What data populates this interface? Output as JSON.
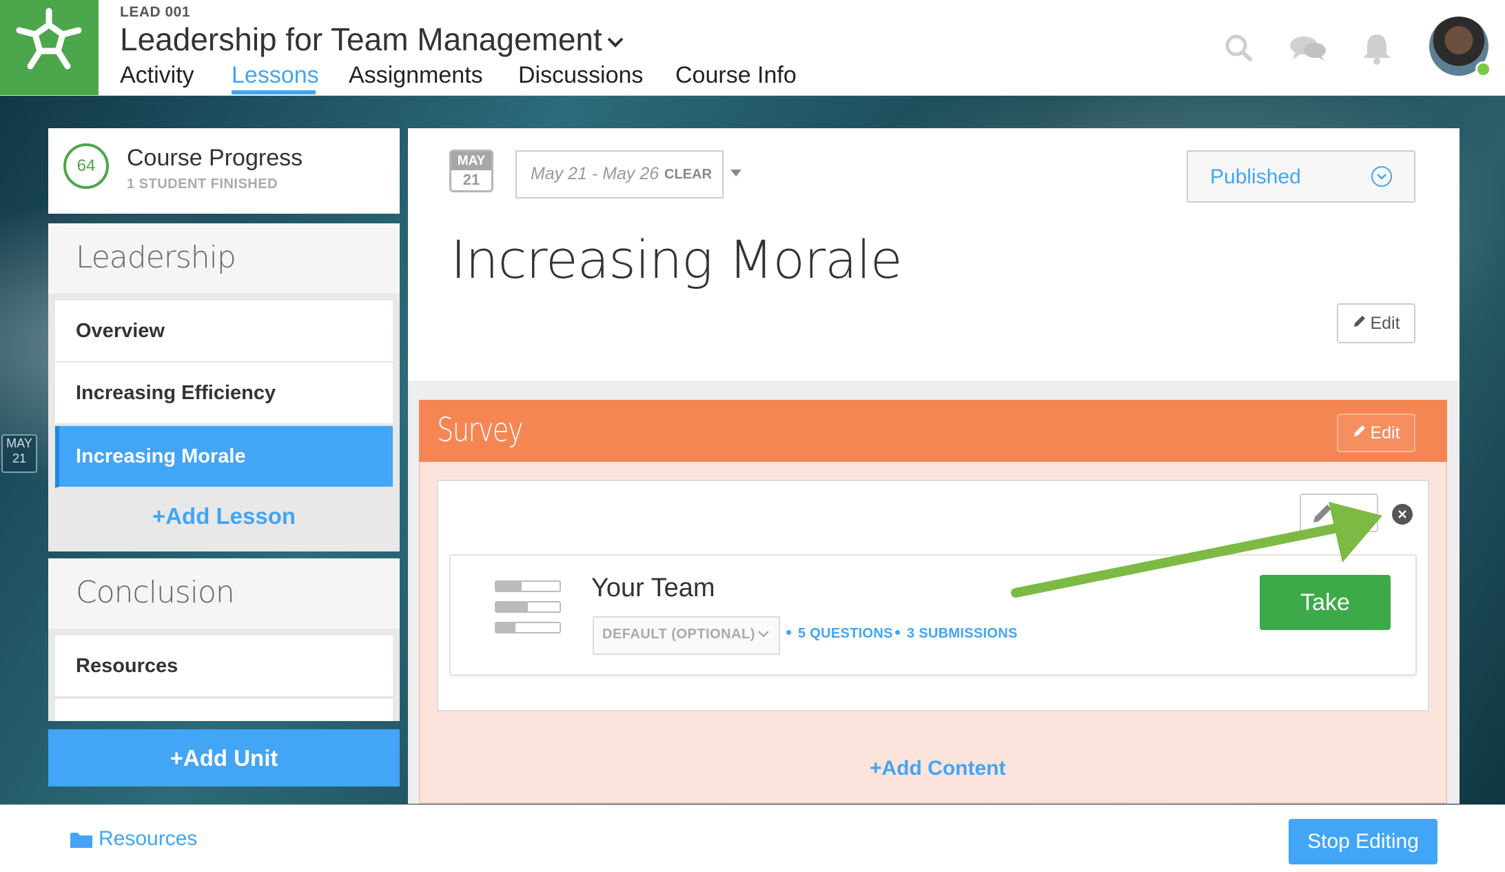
{
  "header": {
    "course_code": "LEAD 001",
    "course_title": "Leadership for Team Management",
    "tabs": [
      {
        "label": "Activity",
        "active": false
      },
      {
        "label": "Lessons",
        "active": true
      },
      {
        "label": "Assignments",
        "active": false
      },
      {
        "label": "Discussions",
        "active": false
      },
      {
        "label": "Course Info",
        "active": false
      }
    ],
    "icons": [
      "search-icon",
      "chat-bubbles-icon",
      "bell-icon"
    ],
    "user_status": "online"
  },
  "sidebar": {
    "progress": {
      "value": "64",
      "title": "Course Progress",
      "subtitle": "1 STUDENT FINISHED"
    },
    "units": [
      {
        "title": "Leadership",
        "lessons": [
          {
            "label": "Overview",
            "active": false
          },
          {
            "label": "Increasing Efficiency",
            "active": false
          },
          {
            "label": "Increasing Morale",
            "active": true
          }
        ],
        "add_lesson_label": "+Add Lesson"
      },
      {
        "title": "Conclusion",
        "lessons": [
          {
            "label": "Resources",
            "active": false
          }
        ]
      }
    ],
    "add_unit_label": "+Add Unit",
    "side_date": {
      "month": "MAY",
      "day": "21"
    }
  },
  "main": {
    "calendar": {
      "month": "MAY",
      "day": "21"
    },
    "date_range": "May 21 - May 26",
    "clear_label": "CLEAR",
    "status_select": "Published",
    "lesson_title": "Increasing Morale",
    "edit_label": "Edit",
    "survey_section": {
      "title": "Survey",
      "edit_label": "Edit",
      "item": {
        "name": "Your Team",
        "grading": "DEFAULT (OPTIONAL)",
        "questions_label": "5 QUESTIONS",
        "submissions_label": "3 SUBMISSIONS",
        "take_label": "Take"
      },
      "add_content_label": "+Add Content"
    }
  },
  "footer": {
    "resources_label": "Resources",
    "stop_editing_label": "Stop Editing"
  },
  "colors": {
    "brand_green": "#4ca64c",
    "accent_blue": "#42a5f5",
    "survey_orange": "#f58653",
    "take_green": "#3daa4a",
    "arrow_green": "#7cba44"
  }
}
